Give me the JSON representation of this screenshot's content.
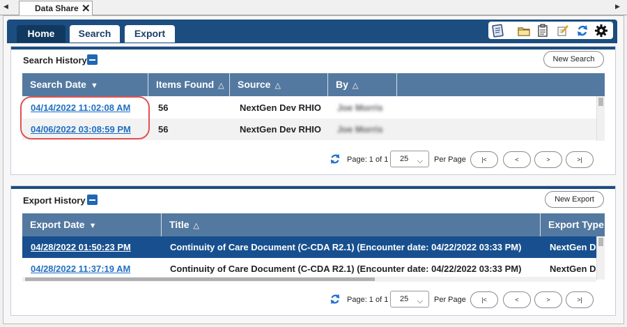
{
  "doc_tab": {
    "title": "Data Share",
    "close": "✕"
  },
  "nav": {
    "home": "Home",
    "search": "Search",
    "export": "Export"
  },
  "search_history": {
    "title": "Search History",
    "new_button": "New Search",
    "columns": [
      {
        "label": "Search Date",
        "sort": "▼"
      },
      {
        "label": "Items Found",
        "sort": "△"
      },
      {
        "label": "Source",
        "sort": "△"
      },
      {
        "label": "By",
        "sort": "△"
      }
    ],
    "rows": [
      {
        "date": "04/14/2022 11:02:08 AM",
        "items": "56",
        "source": "NextGen Dev RHIO",
        "by": "Joe Morris"
      },
      {
        "date": "04/06/2022 03:08:59 PM",
        "items": "56",
        "source": "NextGen Dev RHIO",
        "by": "Joe Morris"
      }
    ],
    "pager": {
      "page_text": "Page: 1 of 1",
      "per_page_value": "25",
      "per_page_label": "Per Page",
      "first": "|<",
      "prev": "<",
      "next": ">",
      "last": ">|"
    }
  },
  "export_history": {
    "title": "Export History",
    "new_button": "New Export",
    "columns": [
      {
        "label": "Export Date",
        "sort": "▼"
      },
      {
        "label": "Title",
        "sort": "△"
      },
      {
        "label": "Export Type",
        "sort": ""
      }
    ],
    "rows": [
      {
        "date": "04/28/2022 01:50:23 PM",
        "title": "Continuity of Care Document (C-CDA R2.1) (Encounter date: 04/22/2022 03:33 PM)",
        "type": "NextGen D",
        "selected": true
      },
      {
        "date": "04/28/2022 11:37:19 AM",
        "title": "Continuity of Care Document (C-CDA R2.1) (Encounter date: 04/22/2022 03:33 PM)",
        "type": "NextGen D",
        "selected": false
      }
    ],
    "pager": {
      "page_text": "Page: 1 of 1",
      "per_page_value": "25",
      "per_page_label": "Per Page",
      "first": "|<",
      "prev": "<",
      "next": ">",
      "last": ">|"
    }
  },
  "colors": {
    "nav_band": "#1b4d80",
    "grid_header": "#5479a0",
    "selected_row": "#18508f",
    "link": "#1f6fc4",
    "highlight": "#e05050"
  },
  "icons": [
    "clipboard-icon",
    "folder-icon",
    "document-icon",
    "edit-icon",
    "refresh-icon",
    "gear-icon"
  ]
}
